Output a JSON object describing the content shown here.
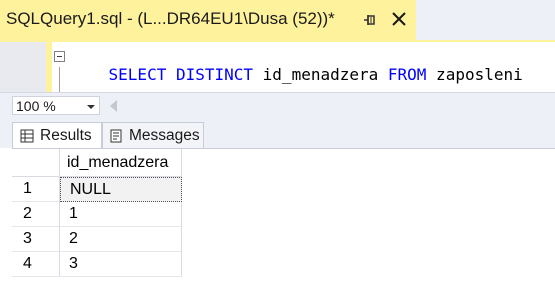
{
  "document_tab": {
    "title": "SQLQuery1.sql - (L...DR64EU1\\Dusa (52))*",
    "pin_icon": "pin-icon",
    "close_icon": "close-icon"
  },
  "editor": {
    "tokens": [
      {
        "text": "SELECT",
        "kind": "keyword"
      },
      {
        "text": " ",
        "kind": "plain"
      },
      {
        "text": "DISTINCT",
        "kind": "keyword"
      },
      {
        "text": " id_menadzera ",
        "kind": "plain"
      },
      {
        "text": "FROM",
        "kind": "keyword"
      },
      {
        "text": " zaposleni",
        "kind": "plain"
      }
    ]
  },
  "zoom": {
    "value": "100 %"
  },
  "results_tabs": [
    {
      "label": "Results",
      "icon": "grid-icon",
      "active": true
    },
    {
      "label": "Messages",
      "icon": "messages-icon",
      "active": false
    }
  ],
  "grid": {
    "columns": [
      "id_menadzera"
    ],
    "rows": [
      {
        "num": "1",
        "value": "NULL",
        "selected": true
      },
      {
        "num": "2",
        "value": "1",
        "selected": false
      },
      {
        "num": "3",
        "value": "2",
        "selected": false
      },
      {
        "num": "4",
        "value": "3",
        "selected": false
      }
    ]
  },
  "colors": {
    "tab_yellow": "#fff29d",
    "keyword_blue": "#0000ff",
    "chrome": "#eef0f7"
  }
}
